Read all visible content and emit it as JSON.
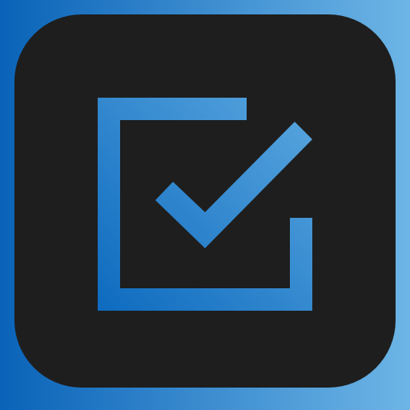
{
  "icon": {
    "name": "checkbox-checked-icon",
    "colors": {
      "background_gradient_start": "#0a63b8",
      "background_gradient_end": "#6db5e6",
      "tile": "#1e1e1e",
      "glyph_gradient_start": "#0e6bbf",
      "glyph_gradient_end": "#5aa7df"
    }
  }
}
